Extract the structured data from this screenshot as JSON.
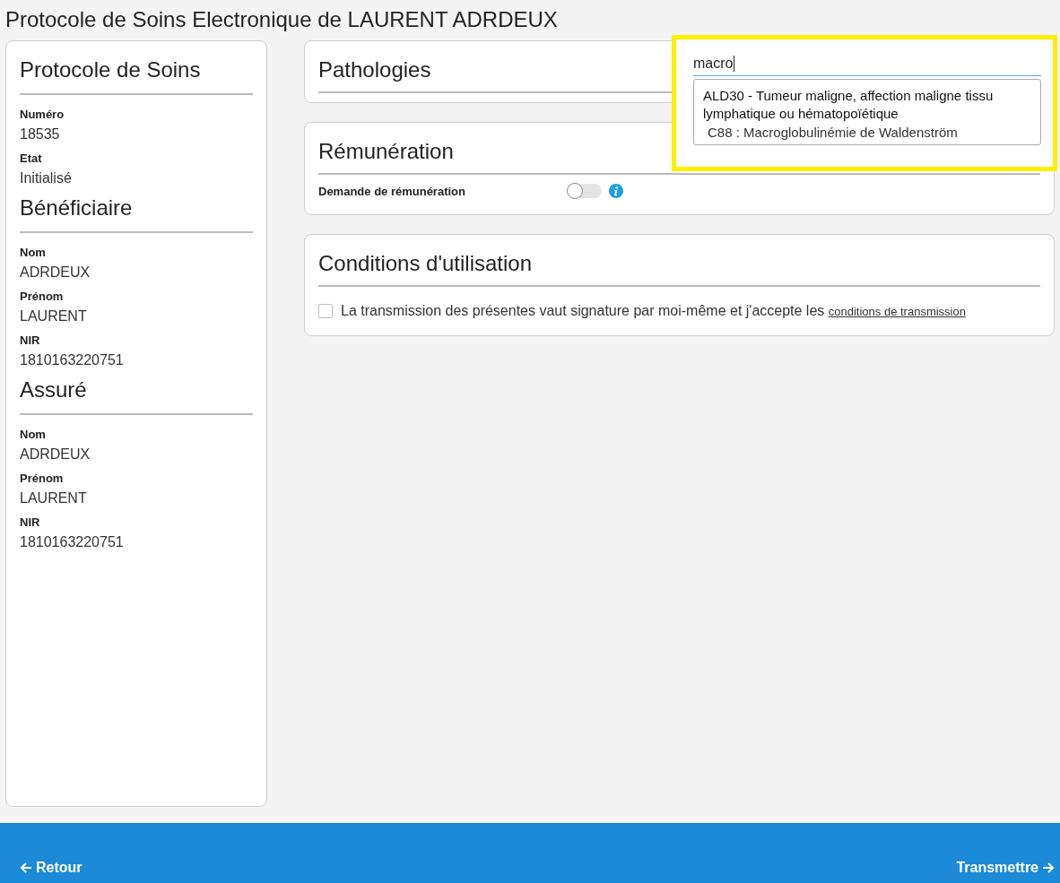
{
  "title": "Protocole de Soins Electronique de LAURENT ADRDEUX",
  "sidebar": {
    "sections": [
      {
        "title": "Protocole de Soins",
        "fields": [
          {
            "label": "Numéro",
            "value": "18535"
          },
          {
            "label": "Etat",
            "value": "Initialisé"
          }
        ]
      },
      {
        "title": "Bénéficiaire",
        "fields": [
          {
            "label": "Nom",
            "value": "ADRDEUX"
          },
          {
            "label": "Prénom",
            "value": "LAURENT"
          },
          {
            "label": "NIR",
            "value": "1810163220751"
          }
        ]
      },
      {
        "title": "Assuré",
        "fields": [
          {
            "label": "Nom",
            "value": "ADRDEUX"
          },
          {
            "label": "Prénom",
            "value": "LAURENT"
          },
          {
            "label": "NIR",
            "value": "1810163220751"
          }
        ]
      }
    ]
  },
  "pathologies": {
    "title": "Pathologies",
    "search": {
      "value": "macro"
    },
    "suggestions": [
      {
        "group": "ALD30 - Tumeur maligne, affection maligne tissu lymphatique ou hématopoïétique",
        "items": [
          "C88 : Macroglobulinémie de Waldenström"
        ]
      }
    ]
  },
  "remuneration": {
    "title": "Rémunération",
    "toggle": {
      "label": "Demande de rémunération",
      "on": false
    }
  },
  "conditions": {
    "title": "Conditions d'utilisation",
    "checkbox": {
      "checked": false,
      "text": "La transmission des présentes vaut signature par moi-même et j'accepte les",
      "link": "conditions de transmission"
    }
  },
  "footer": {
    "back": "Retour",
    "next": "Transmettre"
  }
}
